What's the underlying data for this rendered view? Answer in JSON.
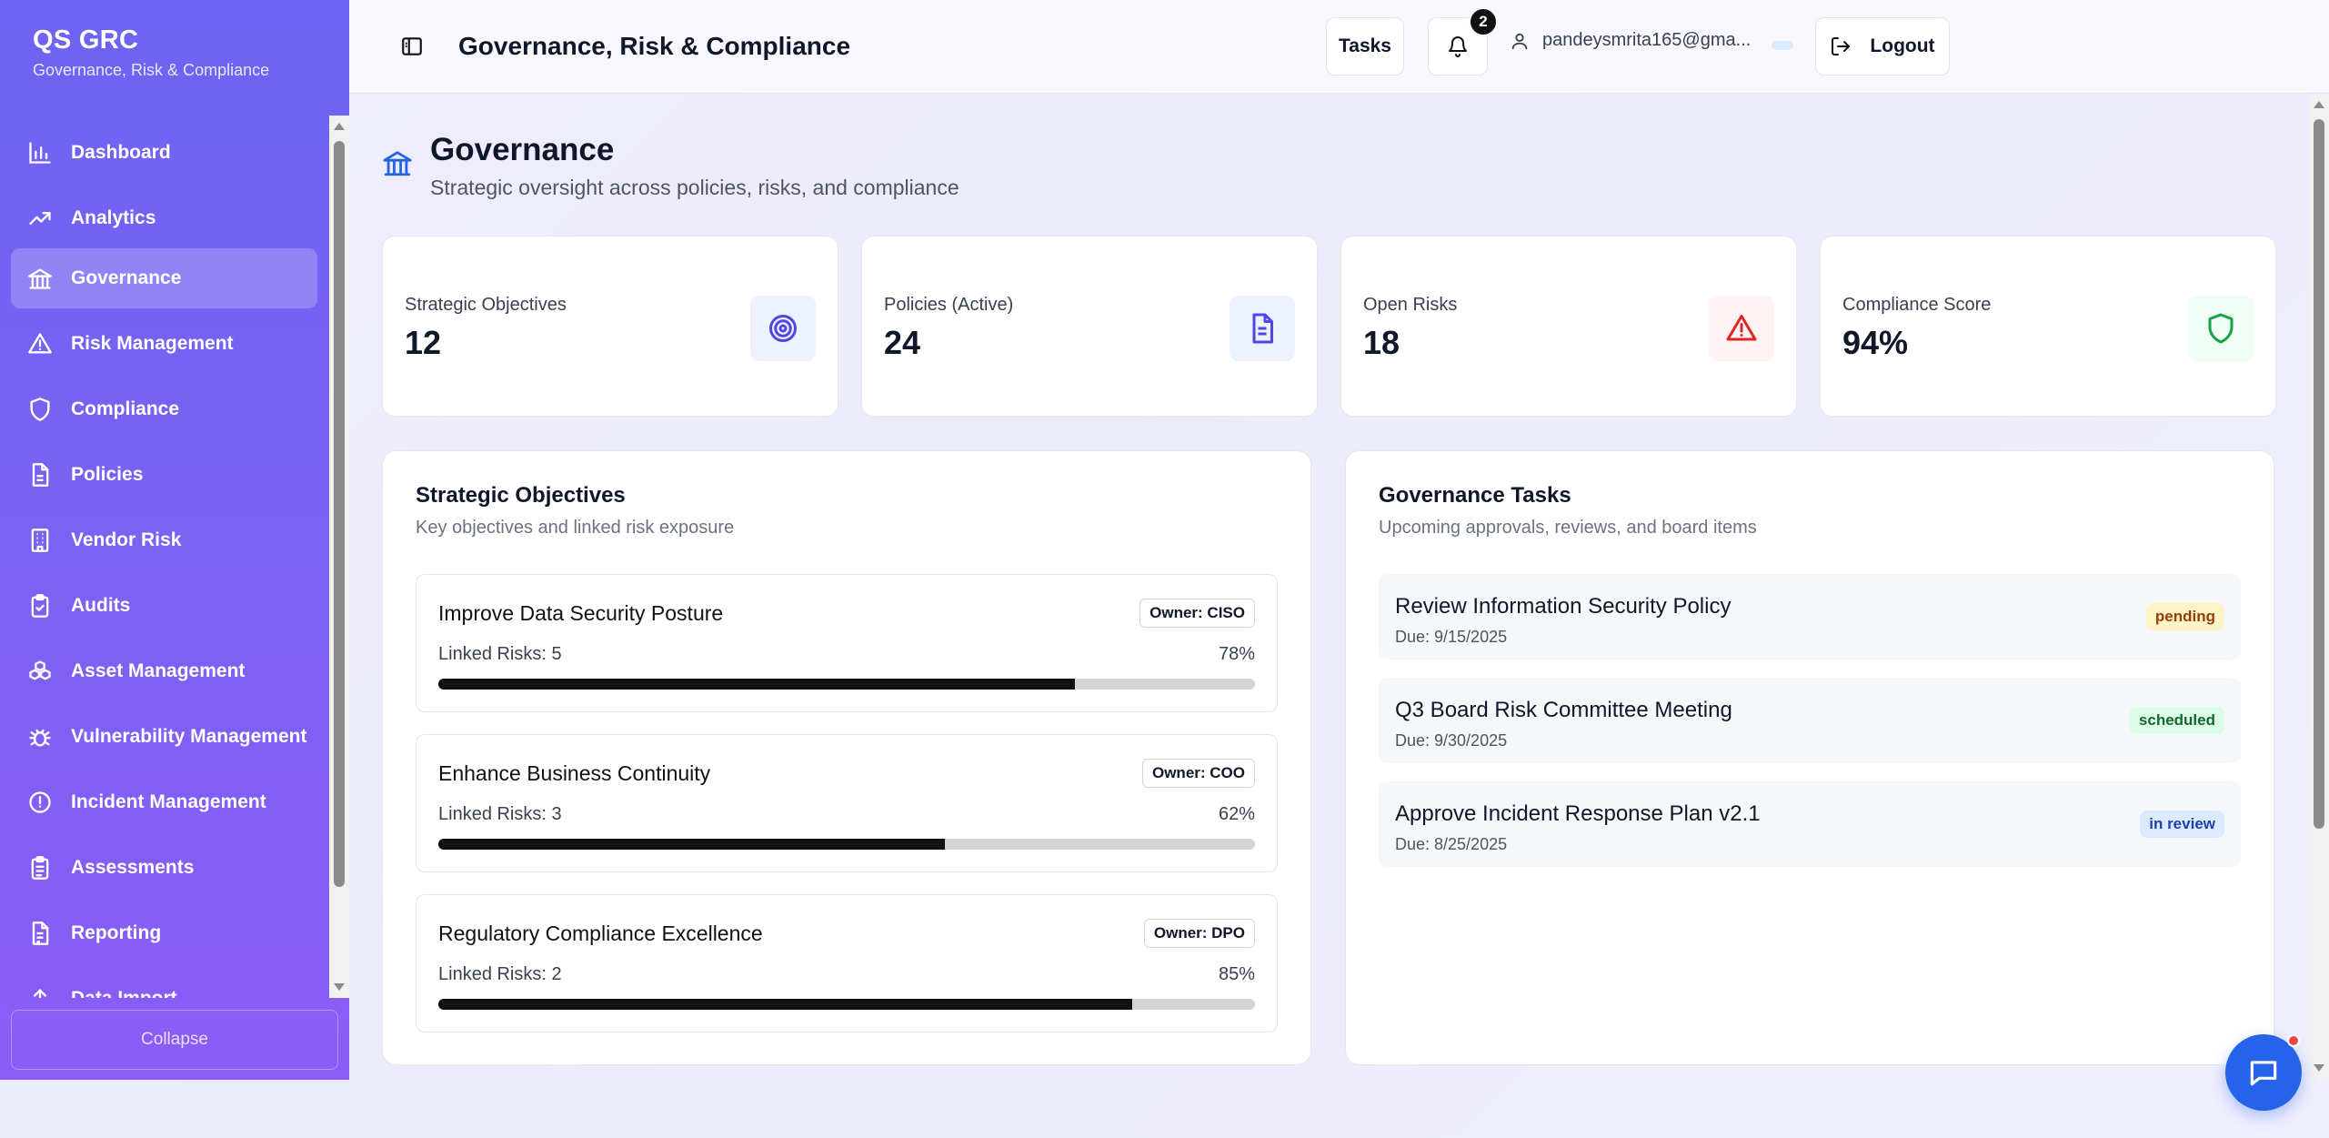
{
  "brand": {
    "title": "QS GRC",
    "subtitle": "Governance, Risk & Compliance"
  },
  "sidebar": {
    "items": [
      {
        "label": "Dashboard",
        "icon": "bar-chart-icon"
      },
      {
        "label": "Analytics",
        "icon": "trending-up-icon"
      },
      {
        "label": "Governance",
        "icon": "landmark-icon",
        "active": true
      },
      {
        "label": "Risk Management",
        "icon": "alert-triangle-icon"
      },
      {
        "label": "Compliance",
        "icon": "shield-icon"
      },
      {
        "label": "Policies",
        "icon": "file-text-icon"
      },
      {
        "label": "Vendor Risk",
        "icon": "building-icon"
      },
      {
        "label": "Audits",
        "icon": "clipboard-check-icon"
      },
      {
        "label": "Asset Management",
        "icon": "boxes-icon"
      },
      {
        "label": "Vulnerability Management",
        "icon": "bug-icon"
      },
      {
        "label": "Incident Management",
        "icon": "alert-circle-icon"
      },
      {
        "label": "Assessments",
        "icon": "clipboard-list-icon"
      },
      {
        "label": "Reporting",
        "icon": "file-report-icon"
      },
      {
        "label": "Data Import",
        "icon": "upload-icon"
      }
    ],
    "collapse_label": "Collapse"
  },
  "header": {
    "title": "Governance, Risk & Compliance",
    "tasks_label": "Tasks",
    "notification_count": "2",
    "user_email": "pandeysmrita165@gma...",
    "logout_label": "Logout"
  },
  "page": {
    "title": "Governance",
    "subtitle": "Strategic oversight across policies, risks, and compliance"
  },
  "stats": [
    {
      "label": "Strategic Objectives",
      "value": "12",
      "icon": "target-icon",
      "color": "#4f46e5"
    },
    {
      "label": "Policies (Active)",
      "value": "24",
      "icon": "document-icon",
      "color": "#4f46e5"
    },
    {
      "label": "Open Risks",
      "value": "18",
      "icon": "warning-icon",
      "color": "#dc2626"
    },
    {
      "label": "Compliance Score",
      "value": "94%",
      "icon": "shield-icon",
      "color": "#16a34a"
    }
  ],
  "objectives": {
    "title": "Strategic Objectives",
    "subtitle": "Key objectives and linked risk exposure",
    "items": [
      {
        "name": "Improve Data Security Posture",
        "owner": "Owner: CISO",
        "risks": "Linked Risks: 5",
        "percent_label": "78%",
        "progress": 78
      },
      {
        "name": "Enhance Business Continuity",
        "owner": "Owner: COO",
        "risks": "Linked Risks: 3",
        "percent_label": "62%",
        "progress": 62
      },
      {
        "name": "Regulatory Compliance Excellence",
        "owner": "Owner: DPO",
        "risks": "Linked Risks: 2",
        "percent_label": "85%",
        "progress": 85
      }
    ]
  },
  "tasks": {
    "title": "Governance Tasks",
    "subtitle": "Upcoming approvals, reviews, and board items",
    "items": [
      {
        "name": "Review Information Security Policy",
        "due": "Due: 9/15/2025",
        "status": "pending",
        "bg": "#fef3c7",
        "fg": "#92400e"
      },
      {
        "name": "Q3 Board Risk Committee Meeting",
        "due": "Due: 9/30/2025",
        "status": "scheduled",
        "bg": "#dcfce7",
        "fg": "#166534"
      },
      {
        "name": "Approve Incident Response Plan v2.1",
        "due": "Due: 8/25/2025",
        "status": "in review",
        "bg": "#dbeafe",
        "fg": "#1e40af"
      }
    ]
  }
}
